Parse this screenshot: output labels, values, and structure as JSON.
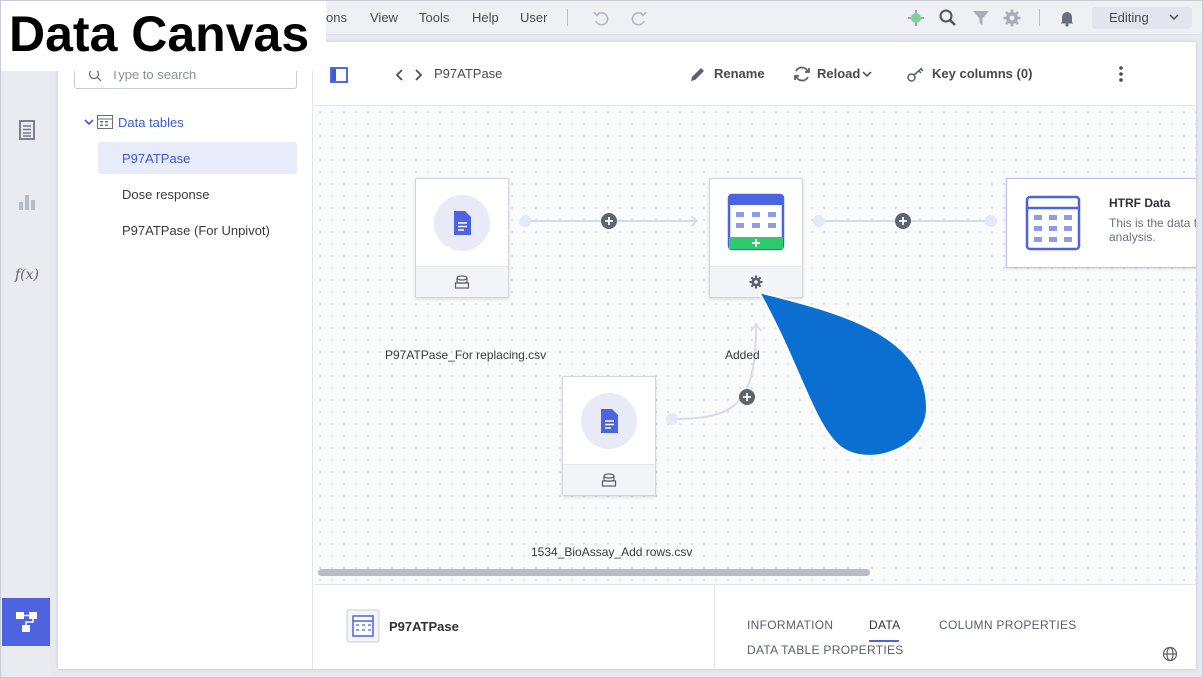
{
  "menu": {
    "items": [
      "ons",
      "View",
      "Tools",
      "Help",
      "User"
    ],
    "mode": "Editing"
  },
  "overlay_title": "Data Canvas",
  "sidebar": {
    "search_placeholder": "Type to search",
    "root": "Data tables",
    "items": [
      {
        "label": "P97ATPase",
        "selected": true
      },
      {
        "label": "Dose response",
        "selected": false
      },
      {
        "label": "P97ATPase (For Unpivot)",
        "selected": false
      }
    ]
  },
  "header": {
    "breadcrumb": "P97ATPase",
    "rename": "Rename",
    "reload": "Reload",
    "key_columns": "Key columns (0)"
  },
  "canvas": {
    "nodes": [
      {
        "label": "P97ATPase_For replacing.csv"
      },
      {
        "label": "Added"
      },
      {
        "label": "1534_BioAssay_Add rows.csv"
      }
    ],
    "result": {
      "title": "HTRF Data",
      "desc1": "This is the data t",
      "desc2": "analysis."
    }
  },
  "bottom": {
    "table_name": "P97ATPase",
    "tabs": [
      "INFORMATION",
      "DATA",
      "COLUMN PROPERTIES",
      "DATA TABLE PROPERTIES"
    ],
    "active_tab": "DATA"
  },
  "colors": {
    "accent": "#4d63e0",
    "drop": "#0a6fd1",
    "link": "#3b5bd6"
  }
}
